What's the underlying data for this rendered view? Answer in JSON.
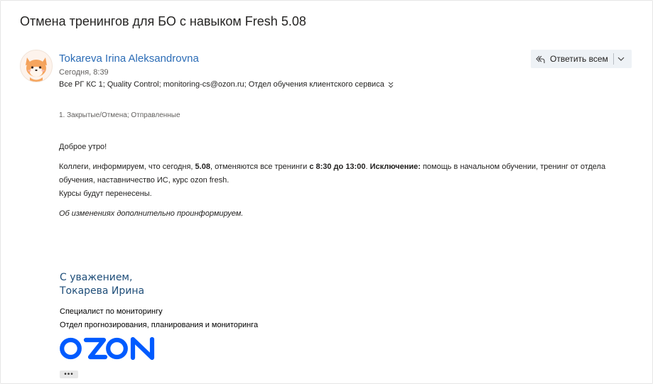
{
  "message": {
    "subject": "Отмена тренингов для БО с навыком Fresh 5.08",
    "sender": {
      "name": "Tokareva Irina Aleksandrovna",
      "avatar_icon": "shiba-dog-avatar"
    },
    "sent_date": "Сегодня, 8:39",
    "recipients": "Все РГ КС 1; Quality Control; monitoring-cs@ozon.ru; Отдел обучения клиентского сервиса",
    "folder_path": "1. Закрытые/Отмена; Отправленные"
  },
  "actions": {
    "reply_all_label": "Ответить всем"
  },
  "body": {
    "greeting": "Доброе утро!",
    "para_part1": "Коллеги, информируем, что сегодня, ",
    "para_date": "5.08",
    "para_part2": ", отменяются все тренинги ",
    "para_time": "с 8:30 до 13:00",
    "para_part3": ". ",
    "para_exception_label": "Исключение:",
    "para_part4": " помощь в начальном обучении, тренинг от отдела",
    "para_line2": "обучения, наставничество ИС, курс ozon fresh.",
    "courses": "Курсы будут перенесены.",
    "note": "Об изменениях дополнительно проинформируем."
  },
  "signature": {
    "regards": "С уважением,",
    "name": "Токарева Ирина",
    "position": "Специалист по мониторингу",
    "department": "Отдел прогнозирования, планирования и мониторинга",
    "logo_text": "OZON",
    "brand_color": "#005bff"
  },
  "more_label": "•••"
}
